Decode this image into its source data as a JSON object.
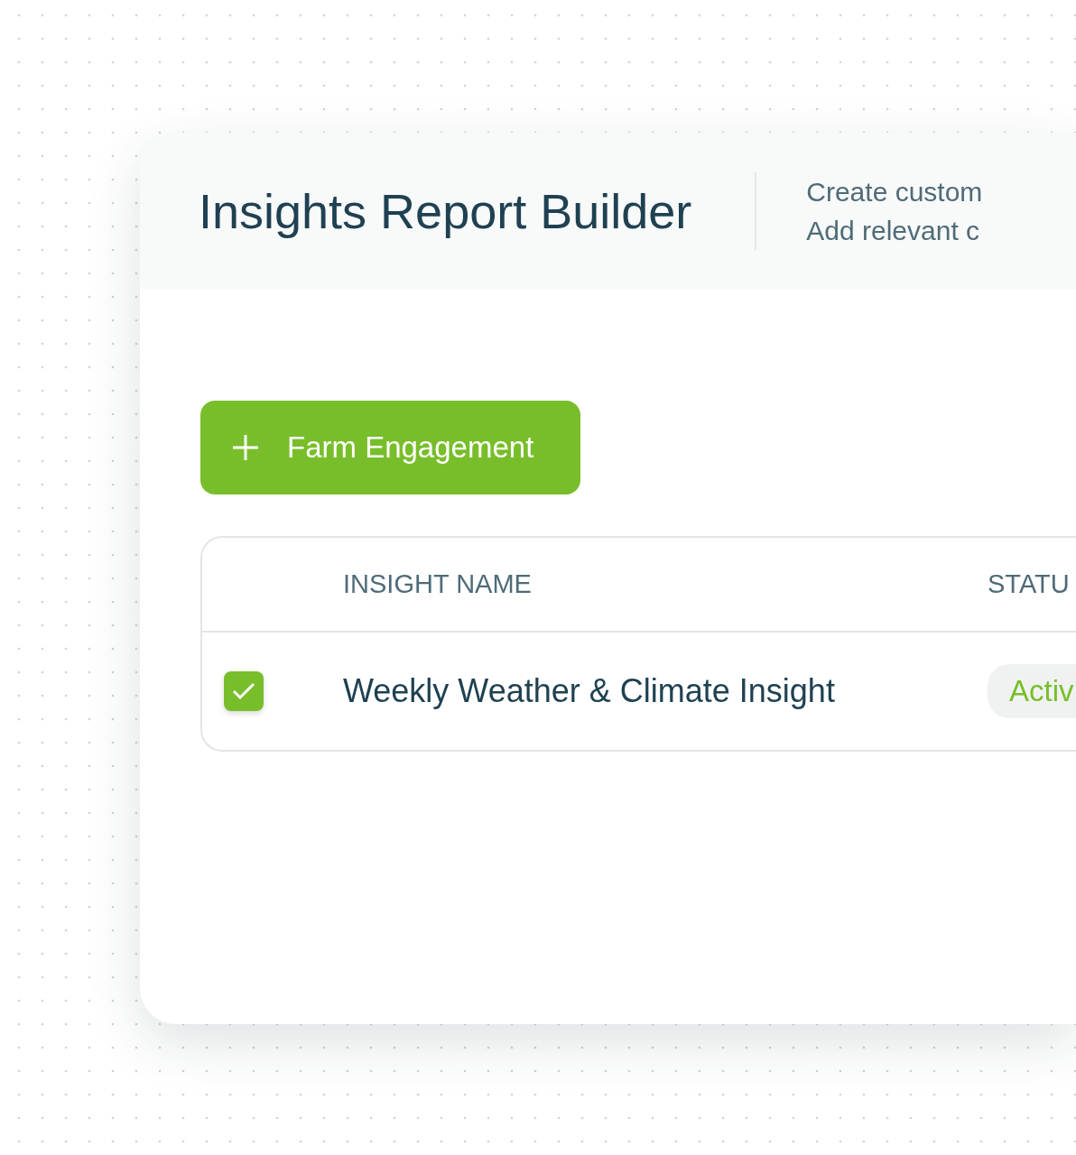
{
  "header": {
    "title": "Insights Report Builder",
    "subtitle_lines": [
      "Create custom",
      "Add relevant c"
    ]
  },
  "add_button": {
    "label": "Farm Engagement"
  },
  "table": {
    "columns": [
      "INSIGHT NAME",
      "STATU"
    ],
    "rows": [
      {
        "checked": true,
        "name": "Weekly Weather & Climate Insight",
        "status": "Activ"
      }
    ]
  }
}
